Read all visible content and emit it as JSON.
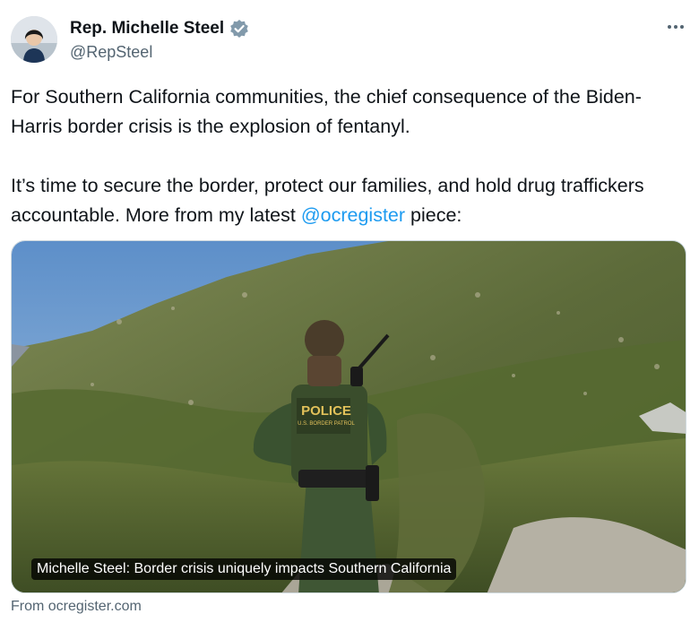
{
  "author": {
    "display_name": "Rep. Michelle Steel",
    "handle": "@RepSteel",
    "verified_icon": "verified-badge-icon"
  },
  "tweet": {
    "line1": "For Southern California communities, the chief consequence of the Biden-Harris border crisis is the explosion of fentanyl.",
    "line2_pre": "It’s time to secure the border, protect our families, and hold drug traffickers accountable. More from my latest ",
    "mention": "@ocregister",
    "line2_post": " piece:"
  },
  "card": {
    "caption": "Michelle Steel: Border crisis uniquely impacts Southern California",
    "patch_text": "POLICE",
    "patch_subtext": "U.S. BORDER PATROL",
    "source": "From ocregister.com"
  },
  "colors": {
    "link": "#1d9bf0",
    "verified": "#829aab",
    "muted": "#536471"
  }
}
